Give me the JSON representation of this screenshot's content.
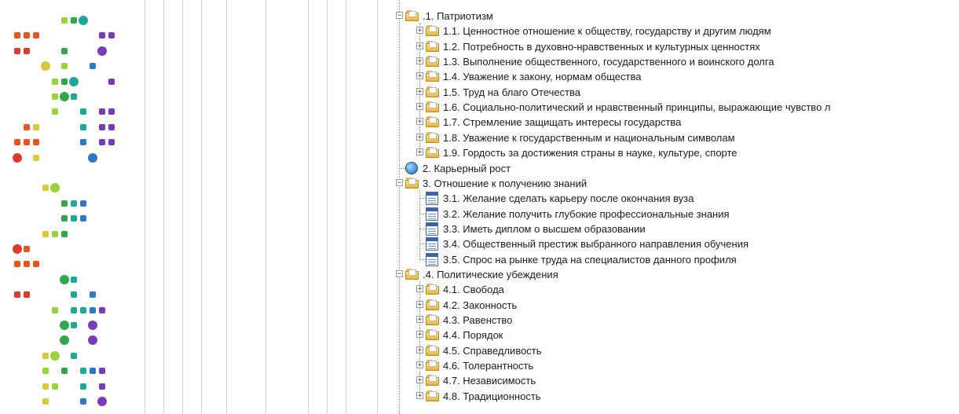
{
  "tree": {
    "items": [
      {
        "level": 0,
        "icon": "folder",
        "expander": "minus",
        "label": ".1. Патриотизм"
      },
      {
        "level": 1,
        "icon": "folder",
        "expander": "plus",
        "label": "1.1. Ценностное отношение к обществу, государству и другим людям"
      },
      {
        "level": 1,
        "icon": "folder",
        "expander": "plus",
        "label": "1.2. Потребность в духовно-нравственных и культурных ценностях"
      },
      {
        "level": 1,
        "icon": "folder",
        "expander": "plus",
        "label": "1.3. Выполнение общественного, государственного и воинского долга"
      },
      {
        "level": 1,
        "icon": "folder",
        "expander": "plus",
        "label": "1.4. Уважение к закону, нормам общества"
      },
      {
        "level": 1,
        "icon": "folder",
        "expander": "plus",
        "label": "1.5. Труд на благо Отечества"
      },
      {
        "level": 1,
        "icon": "folder",
        "expander": "plus",
        "label": "1.6. Социально-политический и нравственный принципы, выражающие чувство л"
      },
      {
        "level": 1,
        "icon": "folder",
        "expander": "plus",
        "label": "1.7. Стремление защищать интересы государства"
      },
      {
        "level": 1,
        "icon": "folder",
        "expander": "plus",
        "label": "1.8. Уважение к государственным и национальным символам"
      },
      {
        "level": 1,
        "icon": "folder",
        "expander": "plus",
        "label": "1.9. Гордость за достижения страны в науке, культуре, спорте"
      },
      {
        "level": 0,
        "icon": "globe",
        "expander": "none",
        "label": "2. Карьерный рост"
      },
      {
        "level": 0,
        "icon": "folder",
        "expander": "minus",
        "label": "3. Отношение к получению знаний"
      },
      {
        "level": 1,
        "icon": "doc",
        "expander": "none",
        "label": "3.1. Желание сделать карьеру после окончания вуза"
      },
      {
        "level": 1,
        "icon": "doc",
        "expander": "none",
        "label": "3.2. Желание получить глубокие профессиональные знания"
      },
      {
        "level": 1,
        "icon": "doc",
        "expander": "none",
        "label": "3.3. Иметь диплом о высшем образовании"
      },
      {
        "level": 1,
        "icon": "doc",
        "expander": "none",
        "label": "3.4. Общественный престиж выбранного направления обучения"
      },
      {
        "level": 1,
        "icon": "doc",
        "expander": "none",
        "label": "3.5. Спрос на рынке труда на специалистов данного профиля"
      },
      {
        "level": 0,
        "icon": "folder",
        "expander": "minus",
        "label": ".4. Политические убеждения"
      },
      {
        "level": 1,
        "icon": "folder",
        "expander": "plus",
        "label": "4.1. Свобода"
      },
      {
        "level": 1,
        "icon": "folder",
        "expander": "plus",
        "label": "4.2. Законность"
      },
      {
        "level": 1,
        "icon": "folder",
        "expander": "plus",
        "label": "4.3. Равенство"
      },
      {
        "level": 1,
        "icon": "folder",
        "expander": "plus",
        "label": "4.4. Порядок"
      },
      {
        "level": 1,
        "icon": "folder",
        "expander": "plus",
        "label": "4.5. Справедливость"
      },
      {
        "level": 1,
        "icon": "folder",
        "expander": "plus",
        "label": "4.6. Толерантность"
      },
      {
        "level": 1,
        "icon": "folder",
        "expander": "plus",
        "label": "4.7. Независимость"
      },
      {
        "level": 1,
        "icon": "folder",
        "expander": "plus",
        "label": "4.8. Традиционность"
      }
    ]
  },
  "colors": {
    "orange": "#e8541f",
    "red": "#e03a2a",
    "yellow": "#d8c93a",
    "lime": "#9bd23a",
    "green": "#2fa84a",
    "teal": "#1ea89a",
    "blue": "#2e78c8",
    "purple": "#7a3bb8",
    "background": "#ffffff"
  }
}
